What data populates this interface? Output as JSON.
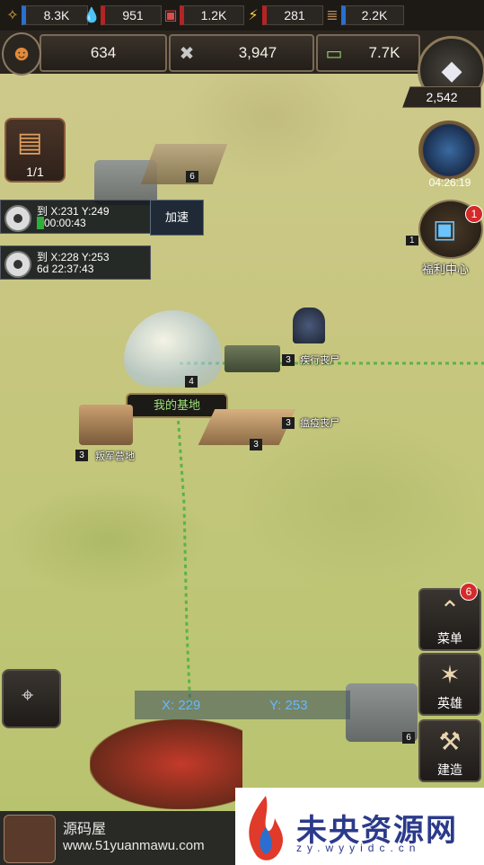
{
  "resources": [
    {
      "name": "food-icon",
      "value": "8.3K",
      "color": "#2a6fd0"
    },
    {
      "name": "water-icon",
      "value": "951",
      "color": "#b32424"
    },
    {
      "name": "supply-icon",
      "value": "1.2K",
      "color": "#b32424"
    },
    {
      "name": "energy-icon",
      "value": "281",
      "color": "#b32424"
    },
    {
      "name": "wood-icon",
      "value": "2.2K",
      "color": "#2a6fd0"
    }
  ],
  "stats": {
    "population": "634",
    "power": "3,947",
    "cash": "7.7K"
  },
  "gems": "2,542",
  "truck": {
    "count": "1/1"
  },
  "marches": [
    {
      "line1": "到 X:231 Y:249",
      "line2": "00:00:43",
      "action": "加速"
    },
    {
      "line1": "到 X:228 Y:253",
      "line2": "6d 22:37:43"
    }
  ],
  "event": {
    "timer": "04:26:19"
  },
  "welfare": {
    "label": "福利中心",
    "badge": "1",
    "level": "1"
  },
  "map": {
    "base_label": "我的基地",
    "base_level": "4",
    "zombie1": {
      "level": "3",
      "name": "疾行丧尸"
    },
    "zombie2": {
      "level": "3",
      "name": "瘟疫丧尸"
    },
    "camp": {
      "level": "3",
      "name": "叛军营地"
    },
    "building_levels": [
      "6",
      "3",
      "6"
    ]
  },
  "side": {
    "menu": {
      "label": "菜单",
      "badge": "6"
    },
    "hero": {
      "label": "英雄"
    },
    "build": {
      "label": "建造"
    }
  },
  "coords": {
    "x": "X: 229",
    "y": "Y: 253"
  },
  "footer": {
    "title": "源码屋",
    "url": "www.51yuanmawu.com"
  },
  "watermark": {
    "text": "未央资源网",
    "sub": "zy.wyyidc.cn"
  }
}
